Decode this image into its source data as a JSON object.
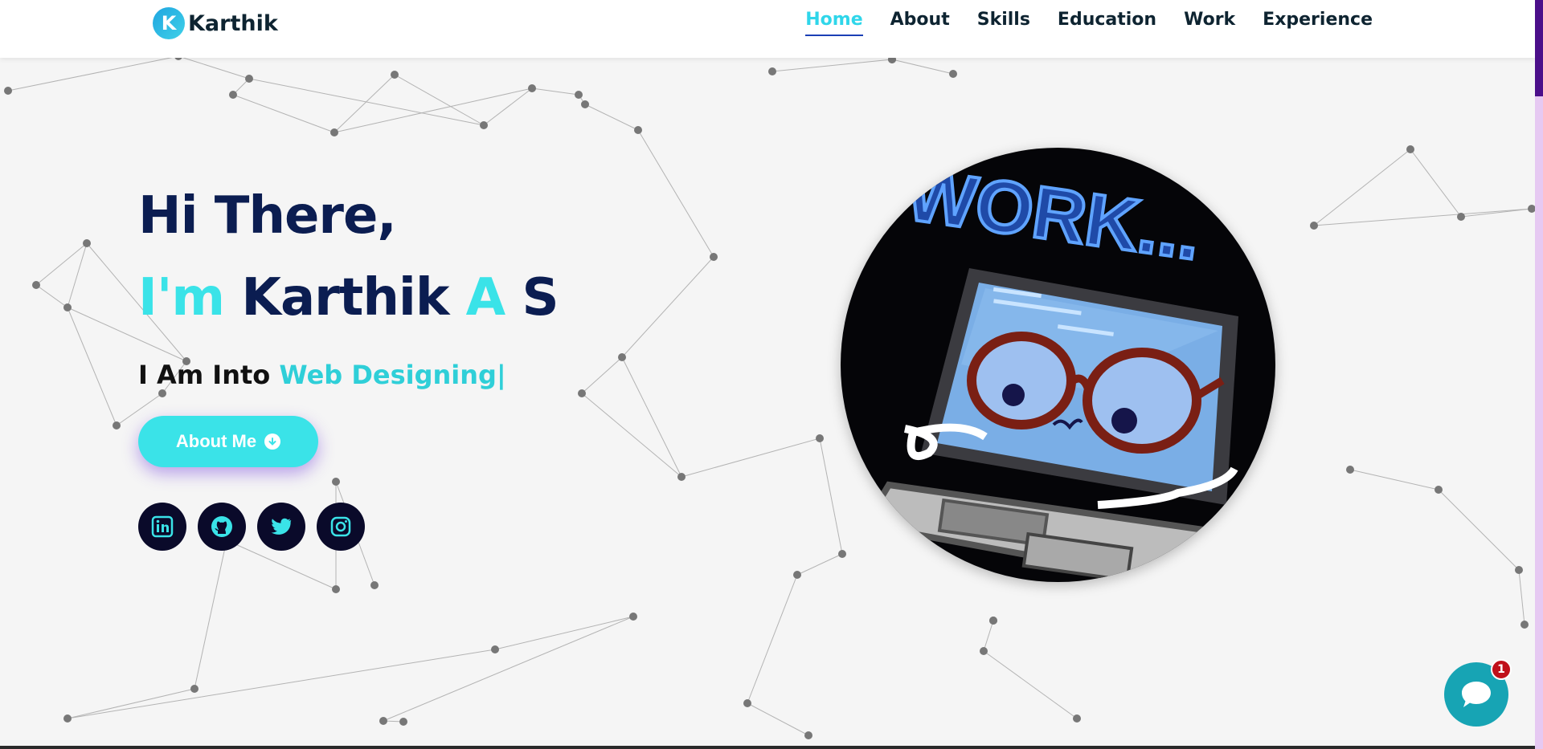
{
  "brand": {
    "initial": "K",
    "name": "Karthik"
  },
  "nav": [
    {
      "label": "Home",
      "active": true
    },
    {
      "label": "About"
    },
    {
      "label": "Skills"
    },
    {
      "label": "Education"
    },
    {
      "label": "Work"
    },
    {
      "label": "Experience"
    }
  ],
  "hero": {
    "greeting": "Hi There,",
    "name_prefix": "I'm",
    "name_main": "Karthik",
    "name_accent": "A",
    "name_suffix": "S",
    "sub_prefix": "I Am Into",
    "sub_typed": "Web Designing|",
    "button_label": "About Me"
  },
  "avatar": {
    "sign_text": "WORK..."
  },
  "socials": [
    "linkedin-icon",
    "github-icon",
    "twitter-icon",
    "instagram-icon"
  ],
  "chat": {
    "badge_count": "1"
  },
  "colors": {
    "accent": "#3ae3e8",
    "navy": "#0b1d51",
    "nav_active": "#2fd6ea"
  }
}
